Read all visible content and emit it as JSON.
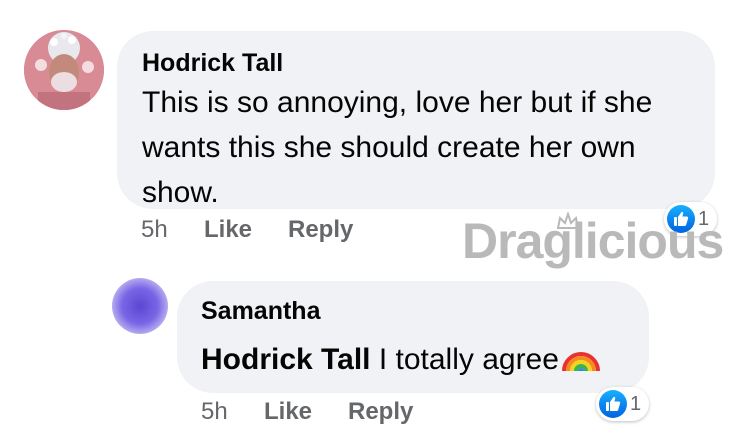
{
  "comments": [
    {
      "author": "Hodrick Tall",
      "text": "This is so annoying, love her but if she wants this she should create her own show.",
      "time": "5h",
      "like_label": "Like",
      "reply_label": "Reply",
      "reaction_count": "1"
    }
  ],
  "reply": {
    "author": "Samantha",
    "mention": "Hodrick Tall",
    "text": " I totally agree",
    "emoji": "rainbow-emoji",
    "time": "5h",
    "like_label": "Like",
    "reply_label": "Reply",
    "reaction_count": "1"
  },
  "watermark": {
    "text": "Draglicious",
    "icon": "crown-icon"
  },
  "colors": {
    "bubble": "#f0f2f5",
    "meta_text": "#65676b",
    "like_blue": "#1877f2",
    "watermark": "#b9b9b9"
  }
}
